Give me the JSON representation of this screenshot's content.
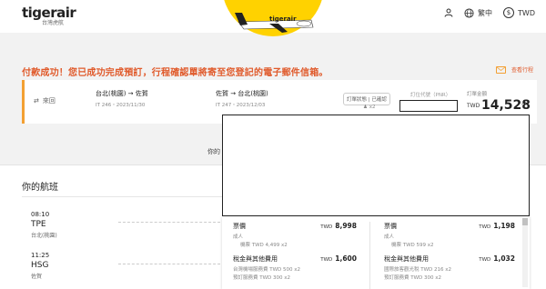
{
  "header": {
    "logo_text": "tigerair",
    "logo_subtext": "台灣虎航",
    "language_label": "繁中",
    "currency_label": "TWD",
    "icons": {
      "user": "user-icon",
      "globe": "globe-icon",
      "currency": "dollar-icon"
    }
  },
  "hero": {
    "plane_text": "tigerair"
  },
  "success_message": "付款成功！您已成功完成預訂，行程確認單將寄至您登記的電子郵件信箱。",
  "view_trip_label": "查看行程",
  "booking": {
    "trip_type": "來回",
    "outbound": {
      "route": "台北(桃園) → 佐賀",
      "meta": "IT 246・2023/11/30"
    },
    "inbound": {
      "route": "佐賀 → 台北(桃園)",
      "meta": "IT 247・2023/12/03"
    },
    "status_label": "訂單狀態 | 已確認",
    "pax_count": "x2",
    "pnr_label": "訂位代號（PNR）",
    "total_label": "訂單金額",
    "total_currency": "TWD",
    "total_amount": "14,528"
  },
  "middle_label": "你的",
  "flights": {
    "title": "你的航班",
    "departure": {
      "time": "08:10",
      "code": "TPE",
      "city": "台北(桃園)"
    },
    "arrival": {
      "time": "11:25",
      "code": "HSG",
      "city": "佐賀"
    }
  },
  "price_panel": {
    "left": {
      "fare_label": "票價",
      "fare_currency": "TWD",
      "fare_amount": "8,998",
      "adult_label": "成人",
      "fare_detail": "機票 TWD 4,499 x2",
      "tax_label": "稅金與其他費用",
      "tax_currency": "TWD",
      "tax_amount": "1,600",
      "tax_detail_1": "台灣機場服務費 TWD 500 x2",
      "tax_detail_2": "預訂服務費 TWD 300 x2"
    },
    "right": {
      "fare_label": "票價",
      "fare_currency": "TWD",
      "fare_amount": "1,198",
      "adult_label": "成人",
      "fare_detail": "機票 TWD 599 x2",
      "tax_label": "稅金與其他費用",
      "tax_currency": "TWD",
      "tax_amount": "1,032",
      "tax_detail_1": "國際旅客觀光稅 TWD 216 x2",
      "tax_detail_2": "預訂服務費 TWD 300 x2"
    }
  },
  "colors": {
    "brand_yellow": "#ffd200",
    "accent_orange": "#e05a2b",
    "card_border": "#f3a033"
  }
}
